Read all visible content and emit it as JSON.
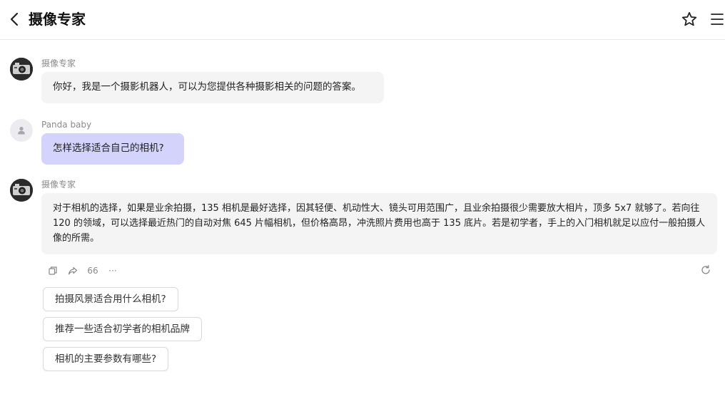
{
  "header": {
    "title": "摄像专家"
  },
  "messages": [
    {
      "sender": "摄像专家",
      "role": "bot",
      "text": "你好，我是一个摄影机器人，可以为您提供各种摄影相关的问题的答案。"
    },
    {
      "sender": "Panda baby",
      "role": "user",
      "text": "怎样选择适合自己的相机?"
    },
    {
      "sender": "摄像专家",
      "role": "bot",
      "text": "对于相机的选择，如果是业余拍摄，135 相机是最好选择，因其轻便、机动性大、镜头可用范围广，且业余拍摄很少需要放大相片，顶多 5x7 就够了。若向往 120 的领域，可以选择最近热门的自动对焦 645 片幅相机，但价格高昂，冲洗照片费用也高于 135 底片。若是初学者，手上的入门相机就足以应付一般拍摄人像的所需。"
    }
  ],
  "message_actions": {
    "quote_glyph": "66",
    "more_glyph": "···"
  },
  "suggestions": [
    "拍摄风景适合用什么相机?",
    "推荐一些适合初学者的相机品牌",
    "相机的主要参数有哪些?"
  ],
  "colors": {
    "user_bubble": "#d3d3fb",
    "bot_bubble": "#f4f4f5"
  }
}
